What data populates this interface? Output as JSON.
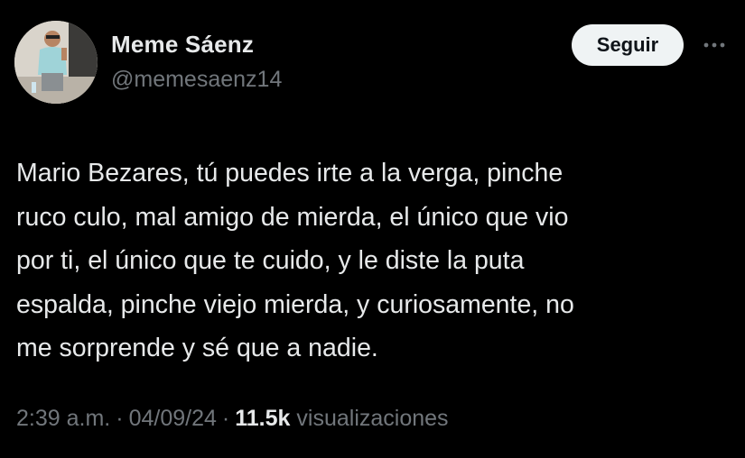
{
  "author": {
    "display_name": "Meme Sáenz",
    "handle": "@memesaenz14",
    "avatar_icon": "profile-photo"
  },
  "follow_button": {
    "label": "Seguir"
  },
  "more_button": {
    "icon": "more-horizontal-icon"
  },
  "tweet": {
    "lines": [
      "Mario Bezares, tú puedes irte a la verga, pinche",
      "ruco culo, mal amigo de mierda, el único que vio",
      "por ti, el único que te cuido, y le diste la puta",
      "espalda, pinche viejo mierda, y curiosamente, no",
      "me sorprende y sé que a nadie."
    ]
  },
  "meta": {
    "time": "2:39 a.m.",
    "separator": "·",
    "date": "04/09/24",
    "views_count": "11.5k",
    "views_label": "visualizaciones"
  },
  "colors": {
    "background": "#000000",
    "primary_text": "#e7e9ea",
    "secondary_text": "#71767b",
    "button_bg": "#eff3f4",
    "button_text": "#0f1419"
  }
}
